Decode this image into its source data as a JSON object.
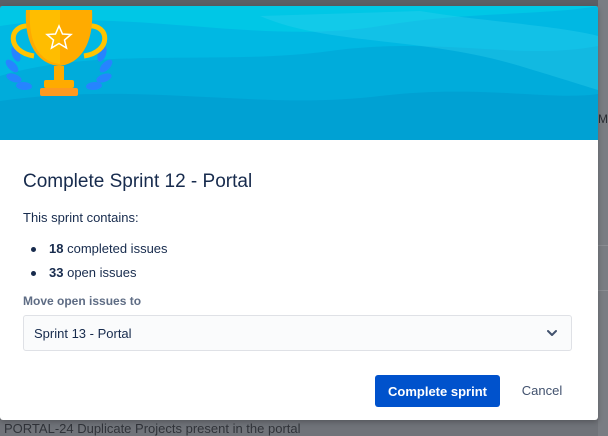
{
  "background": {
    "right_fragment": "Me",
    "bottom_fragment": "PORTAL-24 Duplicate Projects present in the portal"
  },
  "dialog": {
    "title": "Complete Sprint 12 - Portal",
    "contains_label": "This sprint contains:",
    "completed": {
      "count": "18",
      "label": "completed issues"
    },
    "open": {
      "count": "33",
      "label": "open issues"
    },
    "move_label": "Move open issues to",
    "move_select_value": "Sprint 13 - Portal",
    "primary_button": "Complete sprint",
    "cancel_button": "Cancel"
  },
  "colors": {
    "hero": "#00b8e3",
    "primary": "#0052cc",
    "trophy": "#ffab00",
    "laurel": "#2684ff"
  },
  "icons": [
    "trophy-icon",
    "star-icon",
    "chevron-down-icon"
  ]
}
